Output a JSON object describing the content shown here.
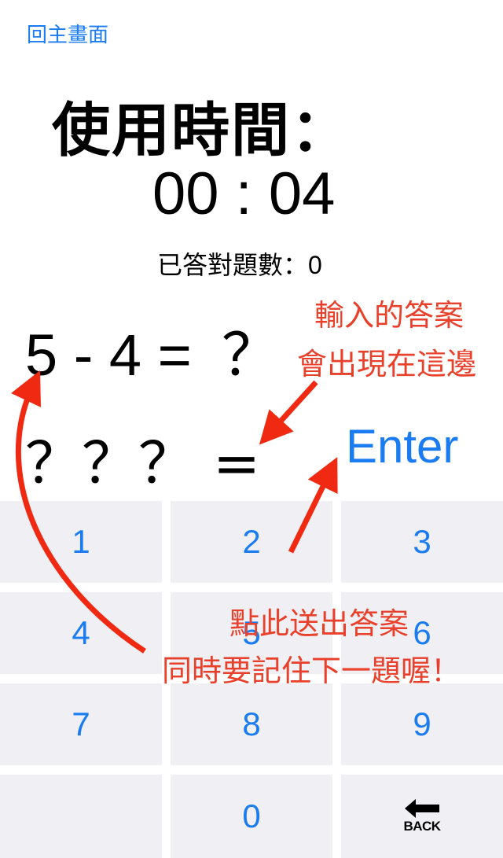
{
  "nav": {
    "home_label": "回主畫面"
  },
  "timer": {
    "title": "使用時間：",
    "value": "00 : 04"
  },
  "score": {
    "label": "已答對題數：",
    "value": "0"
  },
  "question": {
    "expression": "5 - 4 =",
    "mark": "？"
  },
  "answer": {
    "text": "？？？ ="
  },
  "enter": {
    "label": "Enter"
  },
  "keypad": {
    "keys": [
      "1",
      "2",
      "3",
      "4",
      "5",
      "6",
      "7",
      "8",
      "9",
      "",
      "0"
    ],
    "back_label": "BACK"
  },
  "annotations": {
    "answer_hint_line1": "輸入的答案",
    "answer_hint_line2": "會出現在這邊",
    "enter_hint_line1": "點此送出答案",
    "enter_hint_line2": "同時要記住下一題喔！"
  },
  "colors": {
    "accent": "#1a7cf0",
    "annotation": "#e8402a",
    "key_bg": "#efeff4"
  }
}
